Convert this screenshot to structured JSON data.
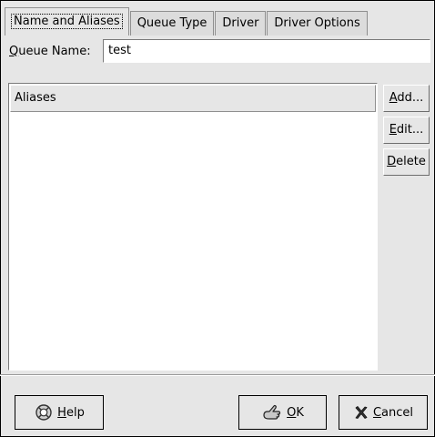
{
  "tabs": [
    {
      "label": "Name and Aliases",
      "active": true
    },
    {
      "label": "Queue Type",
      "active": false
    },
    {
      "label": "Driver",
      "active": false
    },
    {
      "label": "Driver Options",
      "active": false
    }
  ],
  "queue_name": {
    "label_mnemonic": "Q",
    "label_rest": "ueue Name:",
    "value": "test"
  },
  "aliases": {
    "column_header": "Aliases",
    "items": []
  },
  "side_buttons": {
    "add": {
      "mnemonic": "A",
      "rest": "dd..."
    },
    "edit": {
      "mnemonic": "E",
      "rest": "dit..."
    },
    "delete": {
      "mnemonic": "D",
      "rest": "elete"
    }
  },
  "bottom_buttons": {
    "help": {
      "mnemonic": "H",
      "rest": "elp",
      "icon": "help-lifebuoy-icon"
    },
    "ok": {
      "mnemonic": "O",
      "rest": "K",
      "icon": "ok-hand-icon"
    },
    "cancel": {
      "mnemonic": "C",
      "rest": "ancel",
      "icon": "cancel-x-icon"
    }
  }
}
